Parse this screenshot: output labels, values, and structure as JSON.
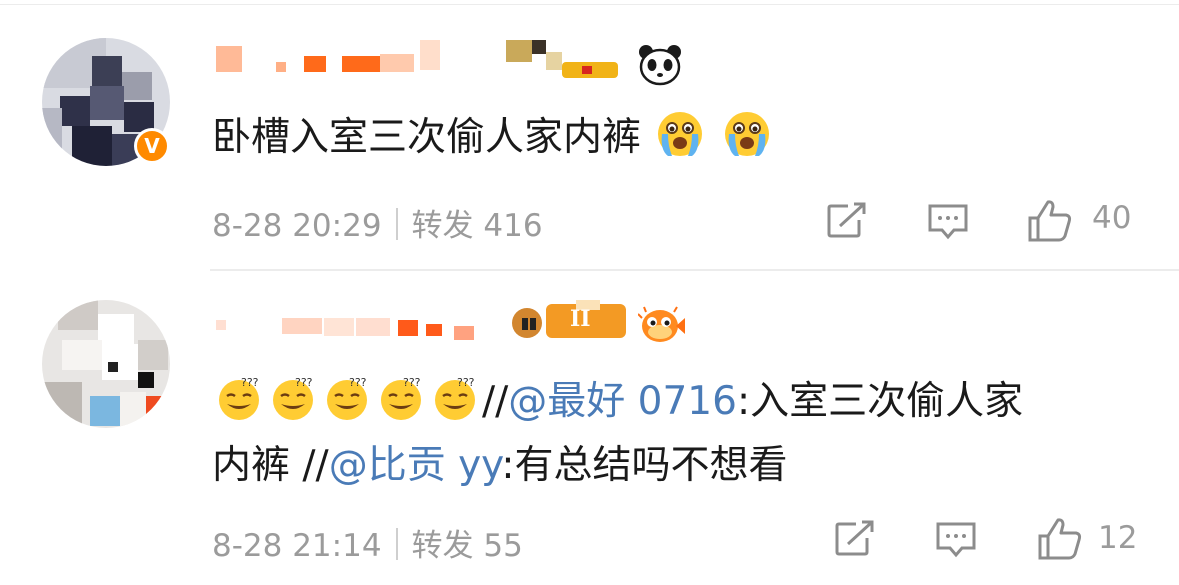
{
  "comments": [
    {
      "text": "卧槽入室三次偷人家内裤",
      "emoji_icons": [
        "crying-face-icon",
        "crying-face-icon"
      ],
      "user_badge_icon": "panda-icon",
      "verified_badge": "V",
      "time": "8-28 20:29",
      "repost_label": "转发 416",
      "like_count": "40"
    },
    {
      "emoji_icons": [
        "smirk-face-icon",
        "smirk-face-icon",
        "smirk-face-icon",
        "smirk-face-icon",
        "smirk-face-icon"
      ],
      "text_line1_sep": "//",
      "mention1": "@最好 0716",
      "text_line1_rest": ":入室三次偷人家",
      "text_line2_start": "内裤 //",
      "mention2": "@比贡 yy",
      "text_line2_rest": ":有总结吗不想看",
      "user_badge_icon": "pufferfish-icon",
      "level_badge": "II",
      "time": "8-28 21:14",
      "repost_label": "转发 55",
      "like_count": "12"
    }
  ],
  "colors": {
    "mention": "#4a7bb7",
    "meta": "#9b9b9b",
    "divider": "#ececec",
    "verified": "#ff8a00"
  }
}
